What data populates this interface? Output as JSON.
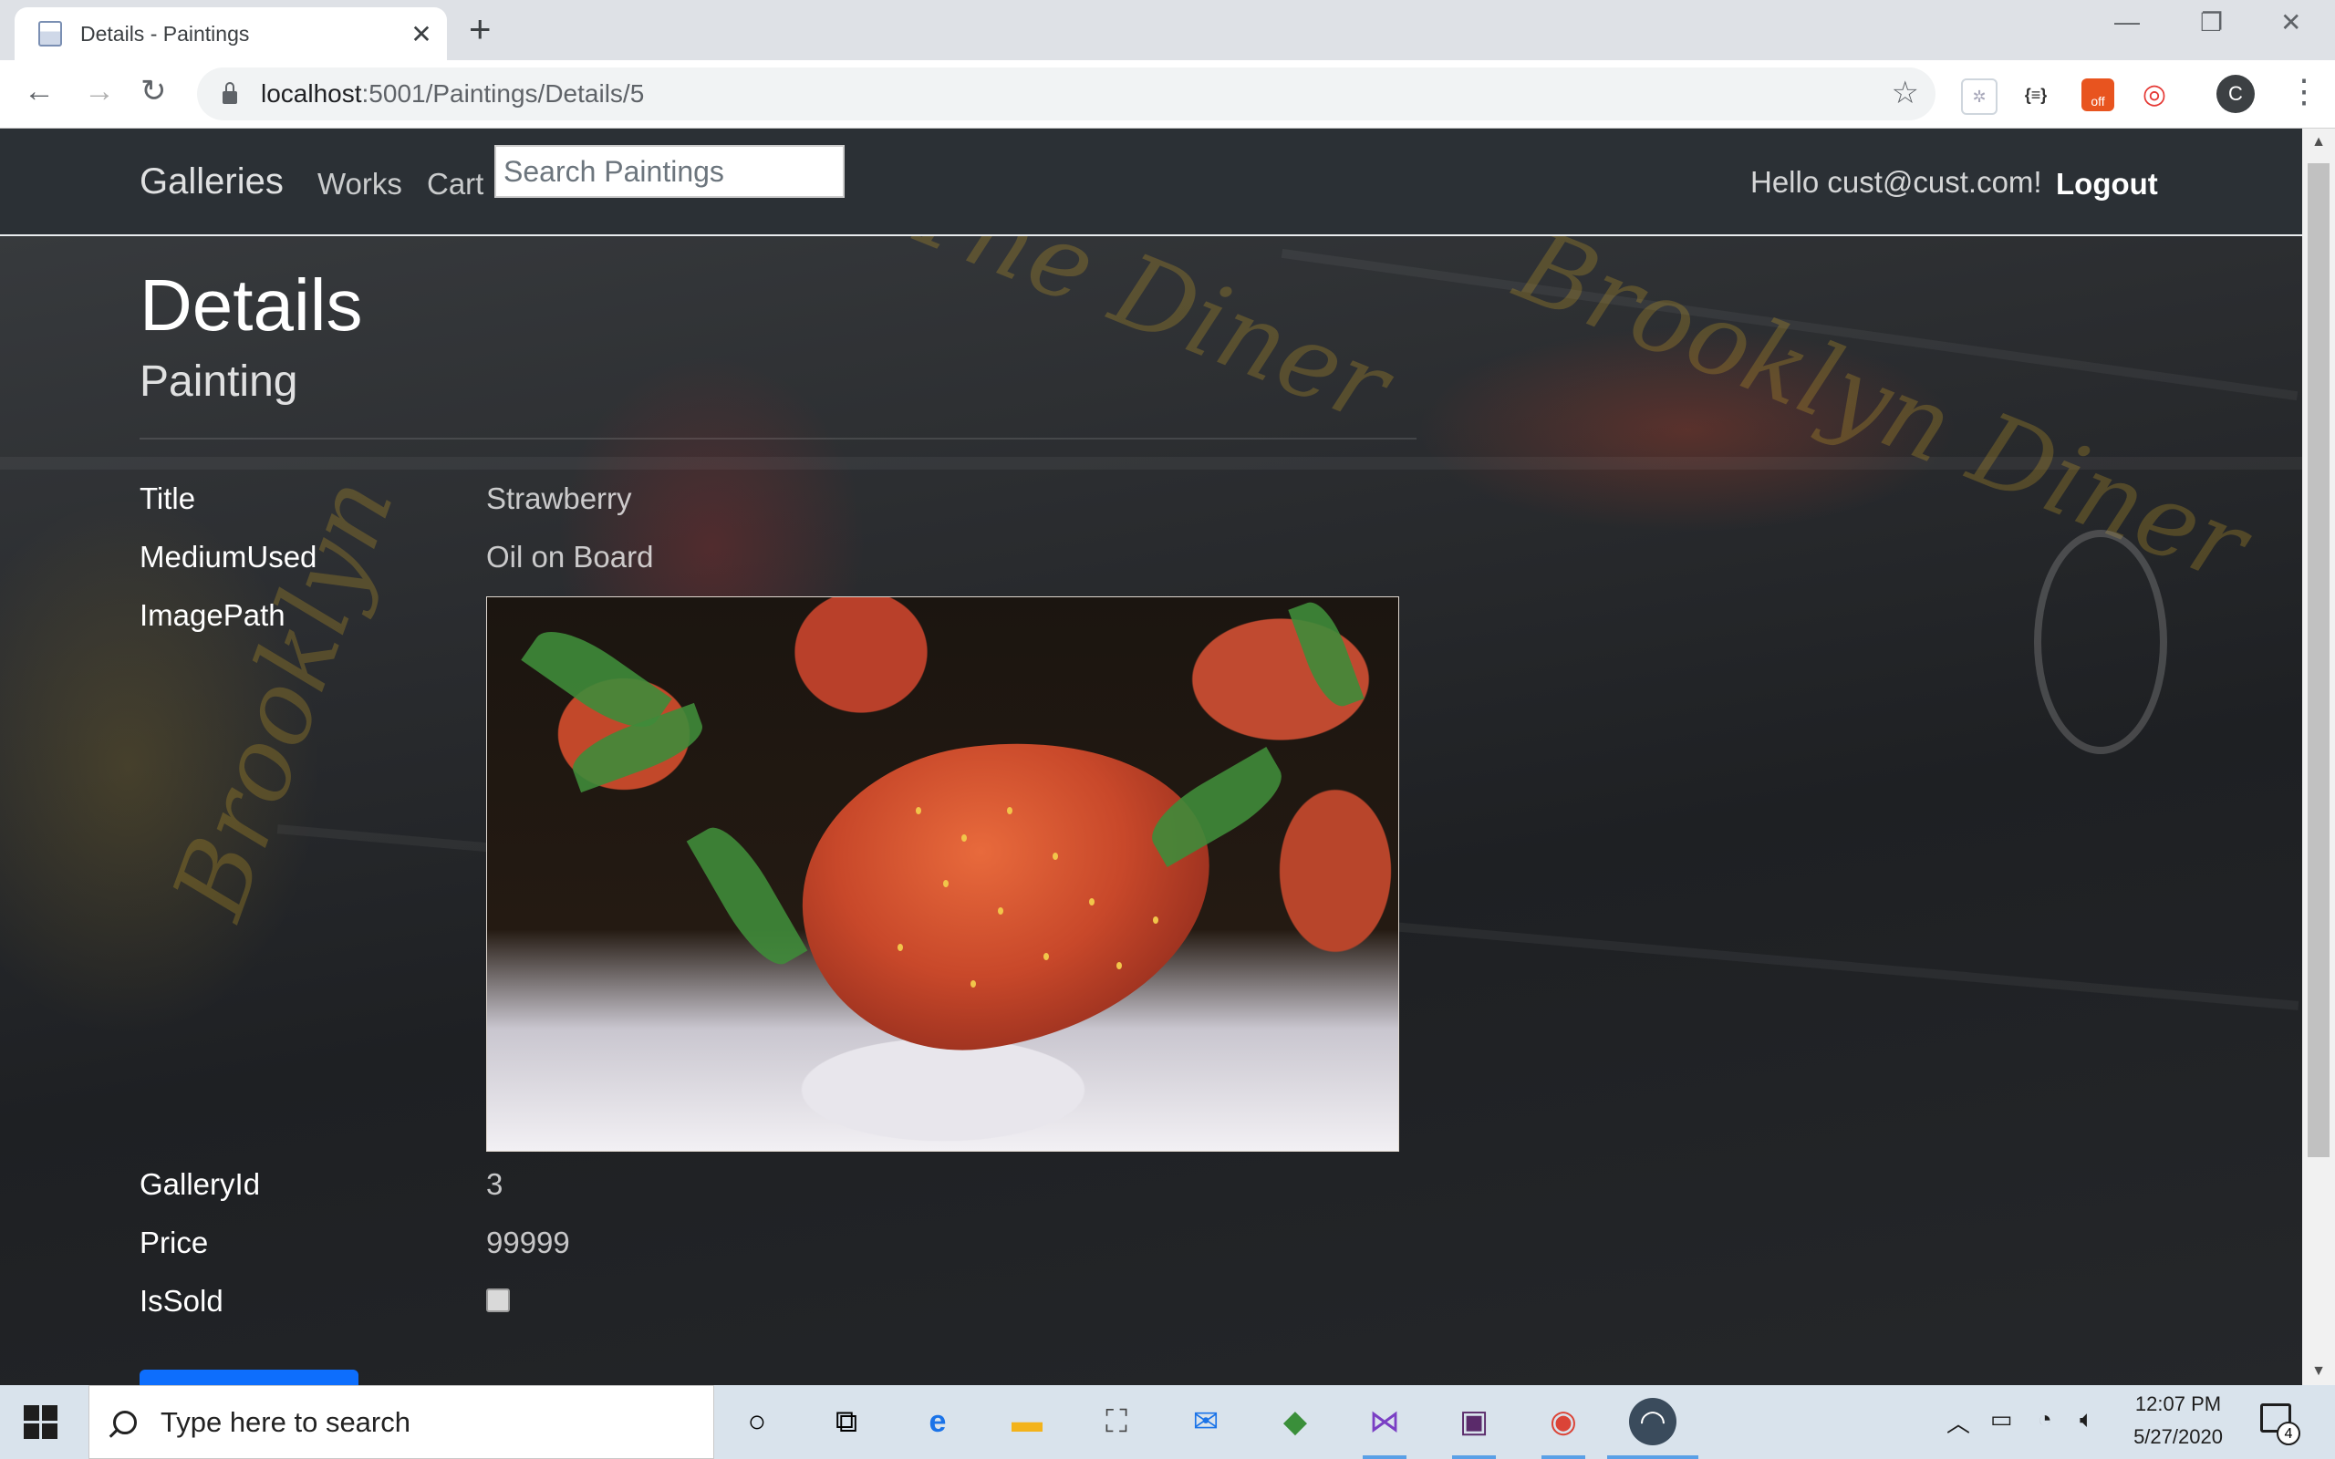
{
  "browser": {
    "tab_title": "Details - Paintings",
    "tab_close": "✕",
    "new_tab": "+",
    "url_host": "localhost",
    "url_path": ":5001/Paintings/Details/5",
    "avatar_letter": "C",
    "window_minimize": "—",
    "window_restore": "❐",
    "window_close": "✕",
    "extension_labels": [
      "{≡}",
      "off"
    ]
  },
  "nav": {
    "brand": "Galleries",
    "links": [
      "Works",
      "Cart"
    ],
    "search_placeholder": "Search Paintings",
    "hello": "Hello cust@cust.com!",
    "logout": "Logout"
  },
  "page": {
    "title": "Details",
    "subtitle": "Painting",
    "fields": [
      {
        "label": "Title",
        "value": "Strawberry"
      },
      {
        "label": "MediumUsed",
        "value": "Oil on Board"
      },
      {
        "label": "ImagePath",
        "value": ""
      },
      {
        "label": "GalleryId",
        "value": "3"
      },
      {
        "label": "Price",
        "value": "99999"
      },
      {
        "label": "IsSold",
        "value": ""
      }
    ],
    "is_sold": false
  },
  "taskbar": {
    "search_placeholder": "Type here to search",
    "time": "12:07 PM",
    "date": "5/27/2020",
    "notification_count": "4"
  },
  "colors": {
    "navbar_bg": "#2b3035",
    "primary_button": "#0d6efd",
    "taskbar_bg": "#d9e3ec"
  }
}
